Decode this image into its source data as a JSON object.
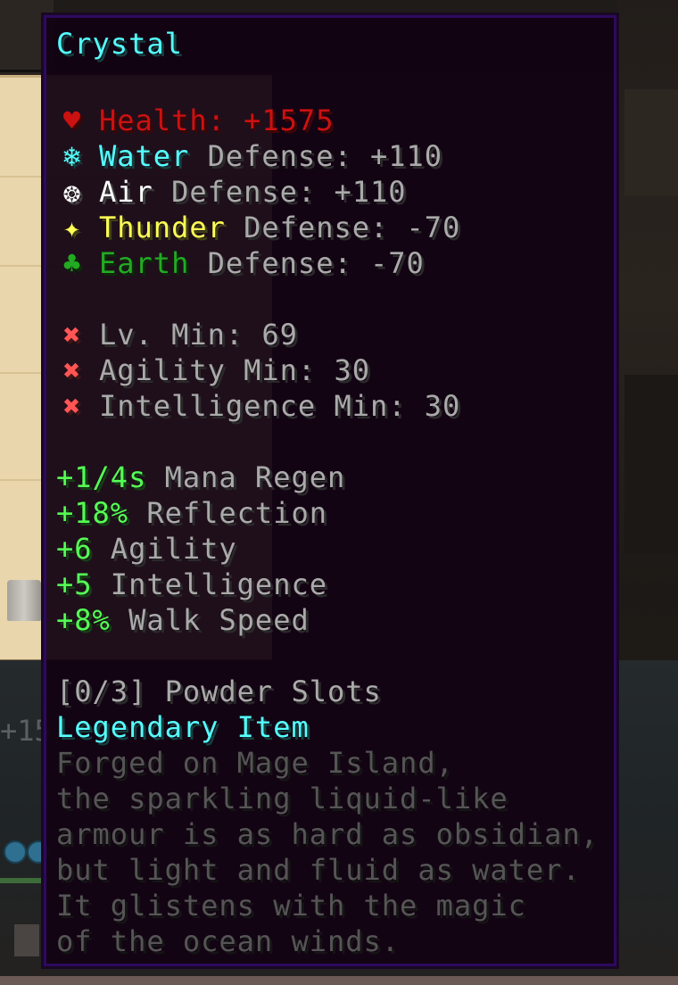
{
  "item": {
    "name": "Crystal",
    "health": {
      "icon": "heart-icon",
      "label": "Health: +1575"
    },
    "defenses": [
      {
        "icon": "water-snowflake-icon",
        "element": "Water",
        "text": " Defense: +110",
        "color": "#55ffff"
      },
      {
        "icon": "air-sun-icon",
        "element": "Air",
        "text": " Defense: +110",
        "color": "#ffffff"
      },
      {
        "icon": "thunder-star-icon",
        "element": "Thunder",
        "text": " Defense: -70",
        "color": "#ffff55"
      },
      {
        "icon": "earth-clover-icon",
        "element": "Earth",
        "text": " Defense: -70",
        "color": "#22aa22"
      }
    ],
    "requirements": [
      {
        "icon": "cross-icon",
        "text": "Lv. Min: 69"
      },
      {
        "icon": "cross-icon",
        "text": "Agility Min: 30"
      },
      {
        "icon": "cross-icon",
        "text": "Intelligence Min: 30"
      }
    ],
    "identifications": [
      {
        "value": "+1/4s",
        "stat": " Mana Regen"
      },
      {
        "value": "+18%",
        "stat": " Reflection"
      },
      {
        "value": "+6",
        "stat": " Agility"
      },
      {
        "value": "+5",
        "stat": " Intelligence"
      },
      {
        "value": "+8%",
        "stat": " Walk Speed"
      }
    ],
    "powder_slots": "[0/3] Powder Slots",
    "tier": "Legendary Item",
    "lore": [
      "Forged on Mage Island,",
      "the sparkling liquid-like",
      "armour is as hard as obsidian,",
      "but light and fluid as water.",
      "It glistens with the magic",
      "of the ocean winds."
    ]
  },
  "background": {
    "partial_number": "+15"
  },
  "colors": {
    "tooltip_bg": "#120212",
    "tooltip_border": "#2d0a5e",
    "name": "#55ffff",
    "health": "#cc1111",
    "positive_stat": "#55ff55",
    "requirement_fail": "#ff5555",
    "lore": "#555555"
  }
}
